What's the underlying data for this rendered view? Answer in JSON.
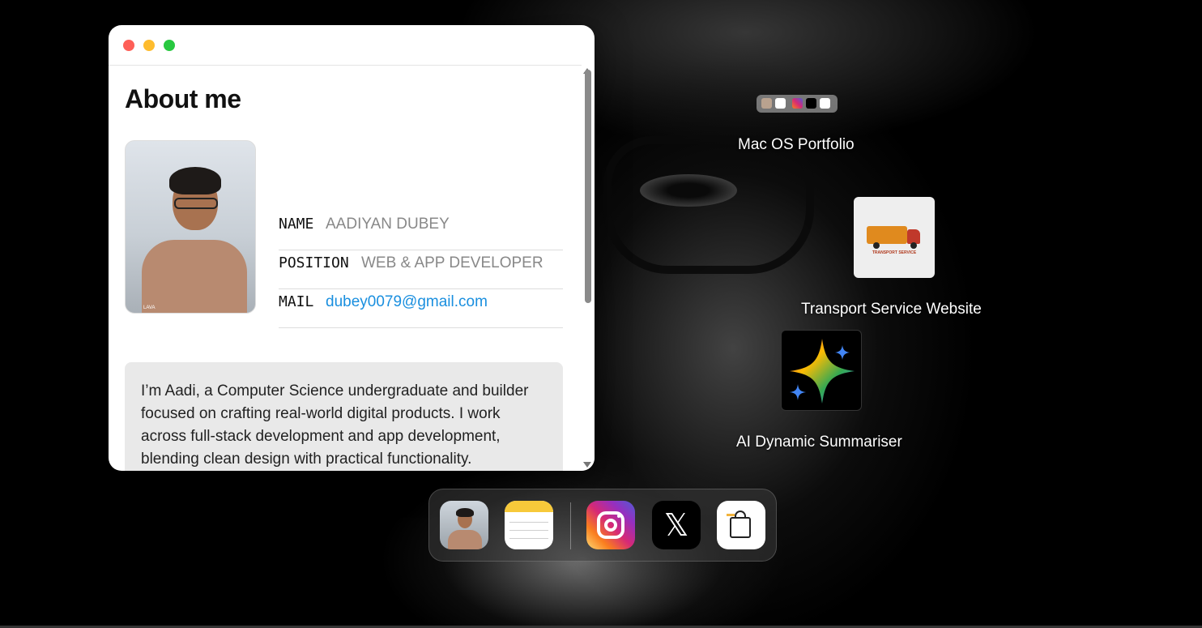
{
  "window": {
    "title": "About me",
    "fields": [
      {
        "label": "NAME",
        "value": "AADIYAN DUBEY"
      },
      {
        "label": "POSITION",
        "value": "WEB & APP DEVELOPER"
      },
      {
        "label": "MAIL",
        "value": "dubey0079@gmail.com"
      }
    ],
    "bio": "I’m Aadi, a Computer Science undergraduate and builder focused on crafting real-world digital products. I work across full-stack development and app development, blending clean design with practical functionality.",
    "profile_watermark": "LAVA"
  },
  "desktop": {
    "items": [
      {
        "label": "Mac OS Portfolio",
        "icon": "macos-portfolio-icon"
      },
      {
        "label": "Transport Service Website",
        "icon": "transport-truck-icon",
        "logo_text": "TRANSPORT SERVICE"
      },
      {
        "label": "AI Dynamic Summariser",
        "icon": "gemini-sparkle-icon"
      }
    ]
  },
  "dock": {
    "apps": [
      {
        "name": "About Me",
        "icon": "profile-photo-icon"
      },
      {
        "name": "Notes",
        "icon": "notes-icon"
      },
      {
        "name": "Instagram",
        "icon": "instagram-icon"
      },
      {
        "name": "X",
        "icon": "x-icon",
        "glyph": "𝕏"
      },
      {
        "name": "Shop",
        "icon": "shopping-bag-icon"
      }
    ]
  },
  "colors": {
    "traffic_red": "#fe5f57",
    "traffic_yellow": "#febc2e",
    "traffic_green": "#28c840",
    "link_blue": "#1a8fdf",
    "bio_background": "#e9e9e9"
  }
}
